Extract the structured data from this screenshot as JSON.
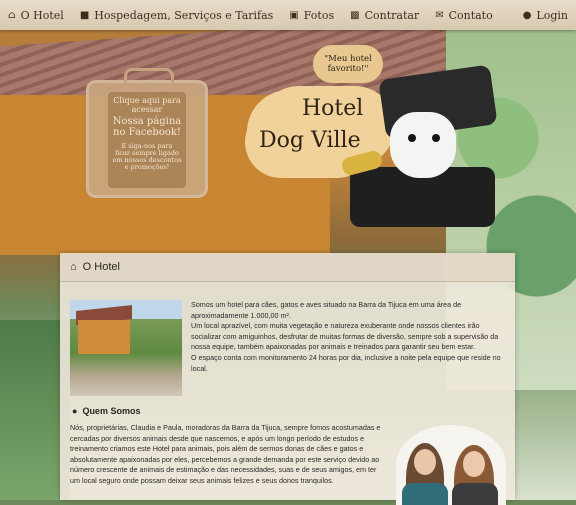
{
  "nav": {
    "items": [
      {
        "label": "O Hotel",
        "icon": "home-icon"
      },
      {
        "label": "Hospedagem, Serviços e Tarifas",
        "icon": "briefcase-icon"
      },
      {
        "label": "Fotos",
        "icon": "image-icon"
      },
      {
        "label": "Contratar",
        "icon": "clipboard-icon"
      },
      {
        "label": "Contato",
        "icon": "envelope-icon"
      }
    ],
    "login": {
      "label": "Login",
      "icon": "user-icon"
    }
  },
  "hero": {
    "facebook_lines": [
      "Clique aqui para",
      "acessar"
    ],
    "facebook_big": [
      "Nossa página",
      "no Facebook!"
    ],
    "facebook_small": [
      "E siga-nos para",
      "ficar sempre ligado",
      "em nossos descontos",
      "e promoções!"
    ],
    "bubble": [
      "\"Meu hotel",
      "favorito!\""
    ],
    "title_line1": "Hotel",
    "title_line2": "Dog Ville"
  },
  "panel": {
    "heading": "O Hotel",
    "intro": [
      "Somos um hotel para cães, gatos e aves situado na Barra da Tijuca em uma área de aproximadamente 1.000,00 m².",
      "Um local aprazível, com muita vegetação e natureza exuberante onde nossos clientes irão socializar com amiguinhos, desfrutar de muitas formas de diversão, sempre sob a supervisão da nossa equipe, também apaixonadas por animais e treinados para garantir seu bem estar.",
      "O espaço conta com monitoramento 24 horas por dia, inclusive a noite pela equipe que reside no local."
    ],
    "about_title": "Quem Somos",
    "about_text": "Nós, proprietárias, Claudia e Paula, moradoras da Barra da Tijuca, sempre fomos acostumadas e cercadas por diversos animais desde que nascemos, e após um longo período de estudos e treinamento criamos este Hotel para animais, pois além de sermos donas de cães e gatos e absolutamente apaixonadas por eles, percebemos a grande demanda por este serviço devido ao número crescente de animais de estimação e das necessidades, suas e de seus amigos, em ter um local seguro onde possam deixar seus animais felizes e seus donos tranquilos."
  }
}
